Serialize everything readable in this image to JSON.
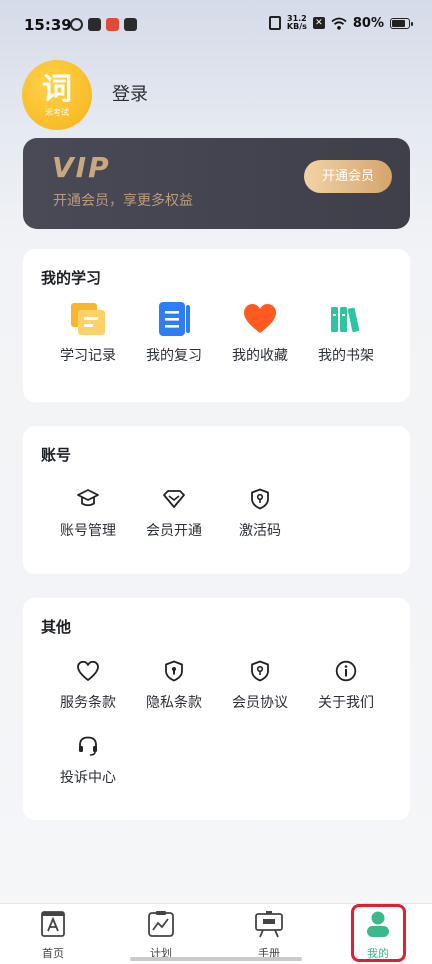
{
  "status_bar": {
    "time": "15:39",
    "net_speed_value": "31.2",
    "net_speed_unit": "KB/s",
    "battery": "80%",
    "battery_level": 0.8
  },
  "profile": {
    "logo_char": "词",
    "logo_sub": "米考试",
    "login_label": "登录"
  },
  "vip": {
    "logo_text": "VIP",
    "subtitle": "开通会员，享更多权益",
    "button_label": "开通会员"
  },
  "study": {
    "title": "我的学习",
    "items": [
      {
        "label": "学习记录",
        "icon": "study-record-icon"
      },
      {
        "label": "我的复习",
        "icon": "review-icon"
      },
      {
        "label": "我的收藏",
        "icon": "favorite-heart-icon"
      },
      {
        "label": "我的书架",
        "icon": "bookshelf-icon"
      }
    ]
  },
  "account": {
    "title": "账号",
    "items": [
      {
        "label": "账号管理",
        "icon": "graduation-cap-icon"
      },
      {
        "label": "会员开通",
        "icon": "diamond-icon"
      },
      {
        "label": "激活码",
        "icon": "shield-key-icon"
      }
    ]
  },
  "other": {
    "title": "其他",
    "items": [
      {
        "label": "服务条款",
        "icon": "heart-outline-icon"
      },
      {
        "label": "隐私条款",
        "icon": "shield-lock-icon"
      },
      {
        "label": "会员协议",
        "icon": "shield-key-icon"
      },
      {
        "label": "关于我们",
        "icon": "info-icon"
      },
      {
        "label": "投诉中心",
        "icon": "headset-icon"
      }
    ]
  },
  "tabbar": {
    "tabs": [
      {
        "label": "首页",
        "icon": "home-book-icon"
      },
      {
        "label": "计划",
        "icon": "plan-chart-icon"
      },
      {
        "label": "手册",
        "icon": "manual-board-icon"
      },
      {
        "label": "我的",
        "icon": "profile-icon"
      }
    ],
    "active_tab": "我的",
    "active_color": "#3db88b"
  },
  "colors": {
    "vip_gold": "#c9a77f",
    "study_yellow": "#f5b82a",
    "study_blue": "#2f7df6",
    "study_orange": "#ff5a1f",
    "study_teal": "#2ec4a0",
    "highlight_red": "#e02030"
  }
}
